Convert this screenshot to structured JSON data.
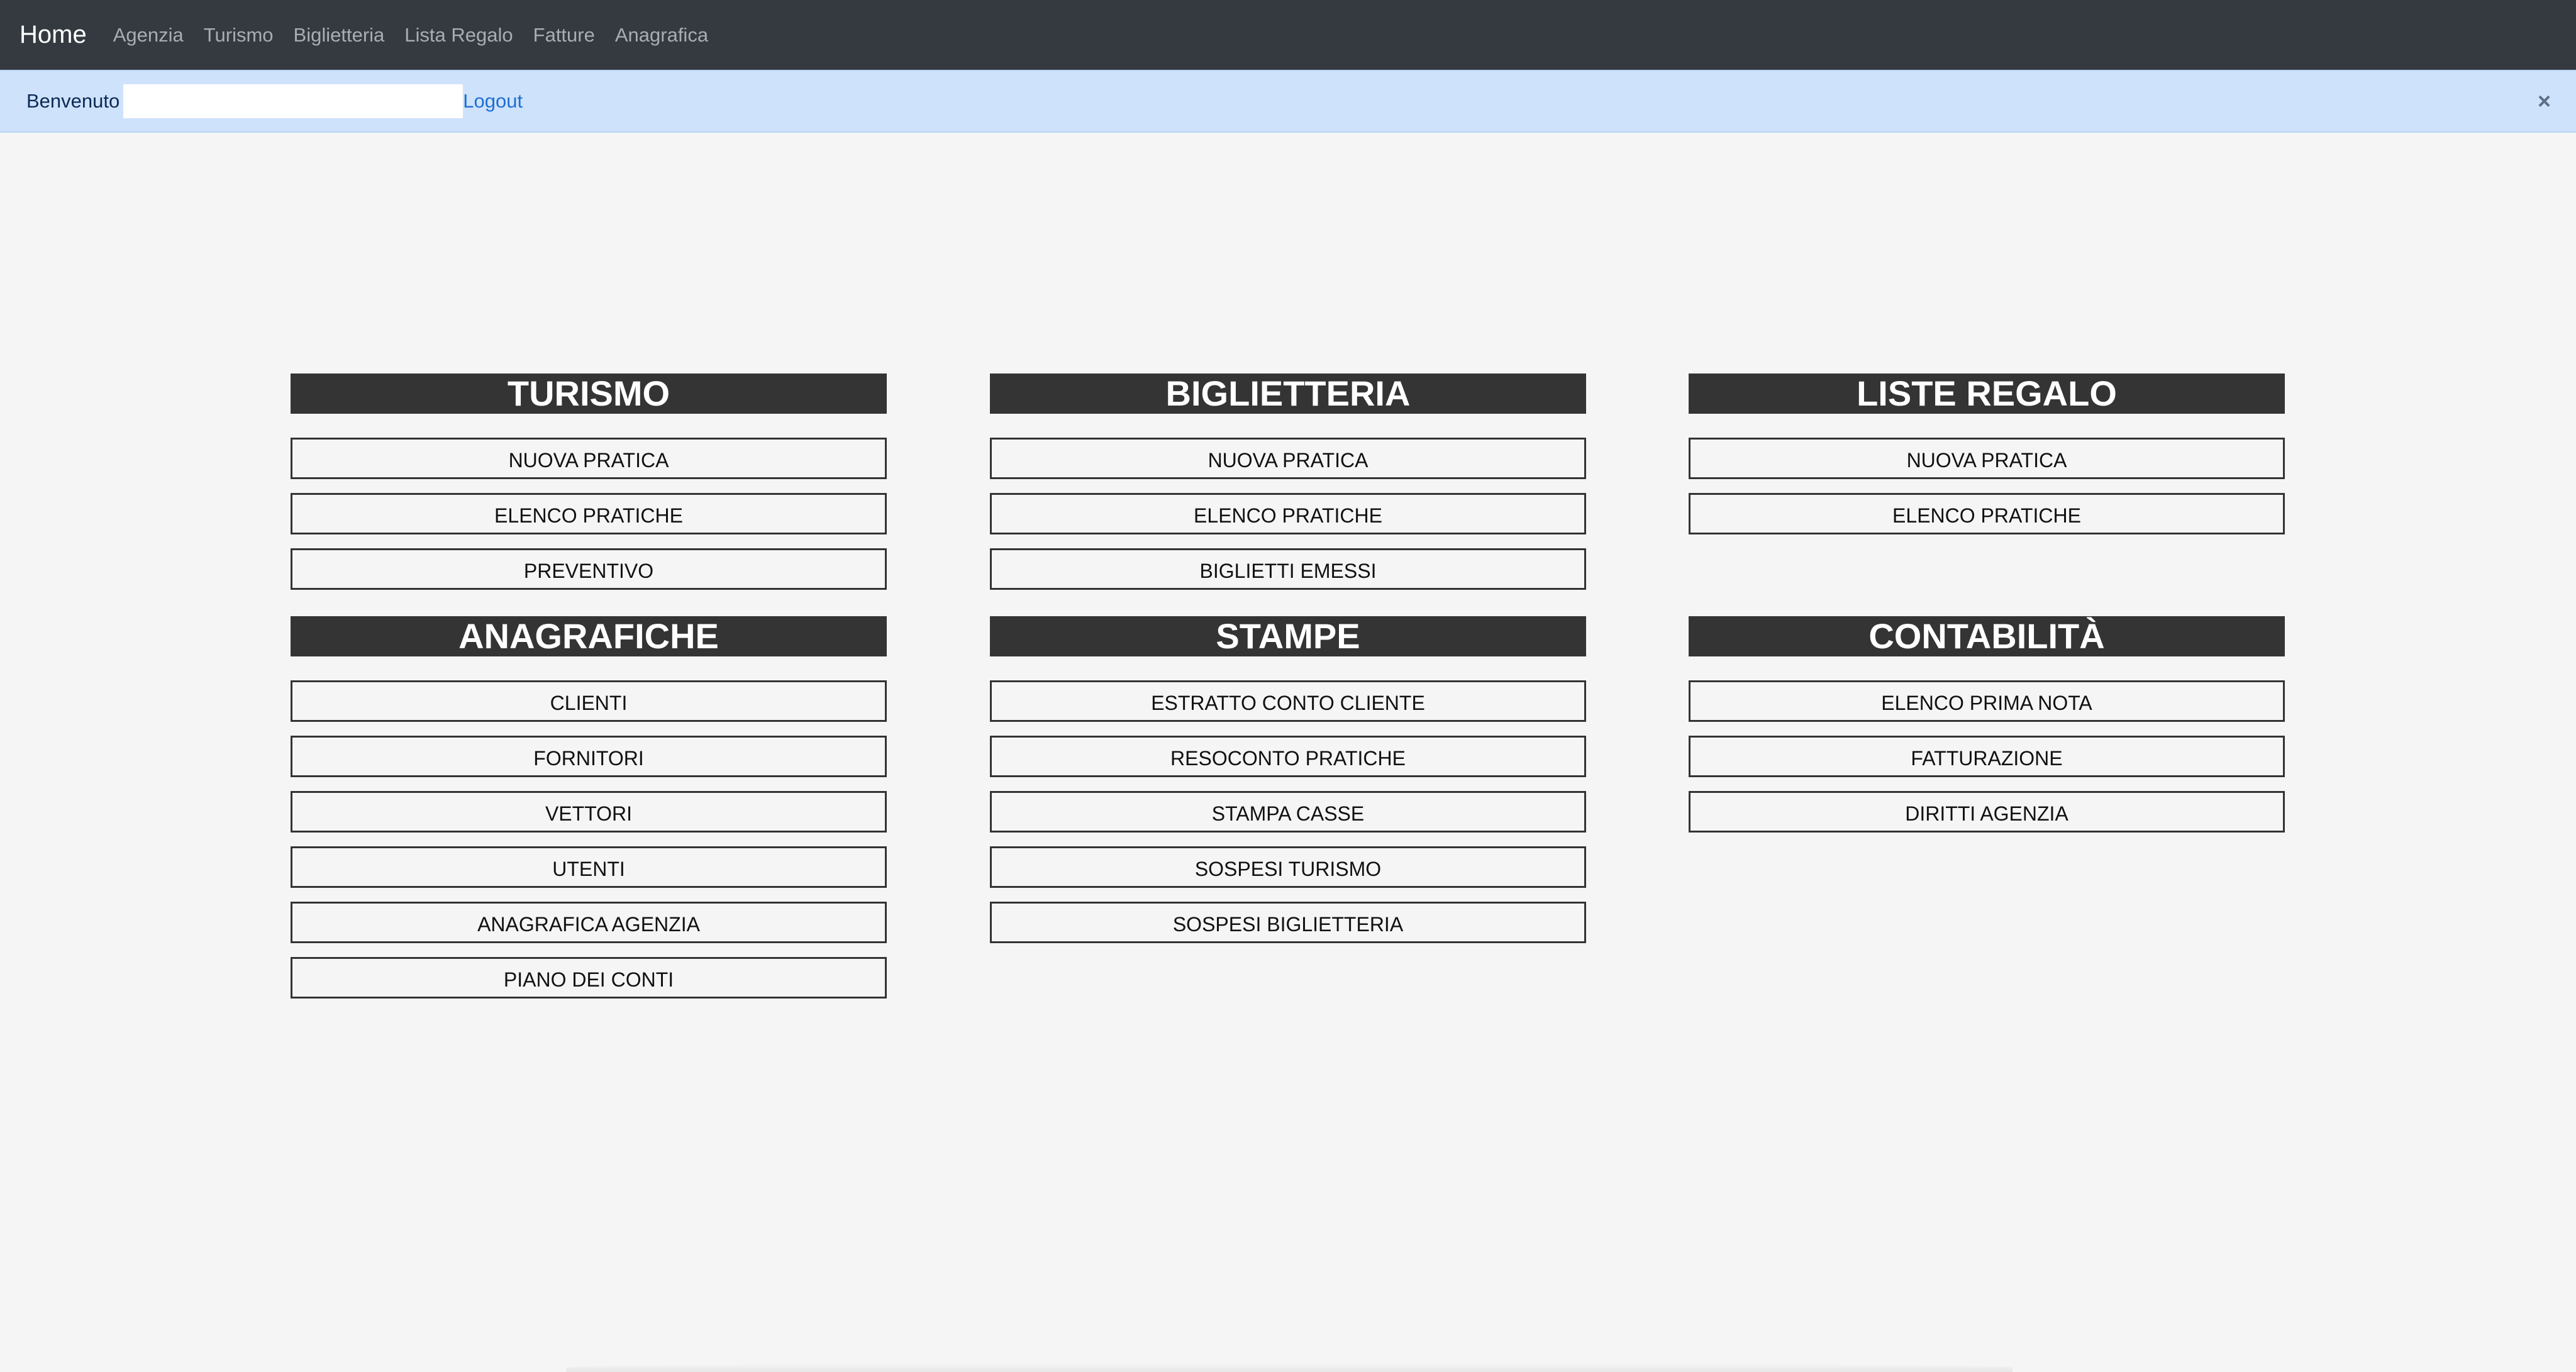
{
  "navbar": {
    "brand": "Home",
    "items": [
      "Agenzia",
      "Turismo",
      "Biglietteria",
      "Lista Regalo",
      "Fatture",
      "Anagrafica"
    ]
  },
  "alert": {
    "welcome": "Benvenuto",
    "logout": "Logout",
    "close": "×"
  },
  "sections": {
    "turismo": {
      "title": "TURISMO",
      "buttons": [
        "NUOVA PRATICA",
        "ELENCO PRATICHE",
        "PREVENTIVO"
      ]
    },
    "biglietteria": {
      "title": "BIGLIETTERIA",
      "buttons": [
        "NUOVA PRATICA",
        "ELENCO PRATICHE",
        "BIGLIETTI EMESSI"
      ]
    },
    "liste_regalo": {
      "title": "LISTE REGALO",
      "buttons": [
        "NUOVA PRATICA",
        "ELENCO PRATICHE"
      ]
    },
    "anagrafiche": {
      "title": "ANAGRAFICHE",
      "buttons": [
        "CLIENTI",
        "FORNITORI",
        "VETTORI",
        "UTENTI",
        "ANAGRAFICA AGENZIA",
        "PIANO DEI CONTI"
      ]
    },
    "stampe": {
      "title": "STAMPE",
      "buttons": [
        "ESTRATTO CONTO CLIENTE",
        "RESOCONTO PRATICHE",
        "STAMPA CASSE",
        "SOSPESI TURISMO",
        "SOSPESI BIGLIETTERIA"
      ]
    },
    "contabilita": {
      "title": "CONTABILITÀ",
      "buttons": [
        "ELENCO PRIMA NOTA",
        "FATTURAZIONE",
        "DIRITTI AGENZIA"
      ]
    }
  }
}
